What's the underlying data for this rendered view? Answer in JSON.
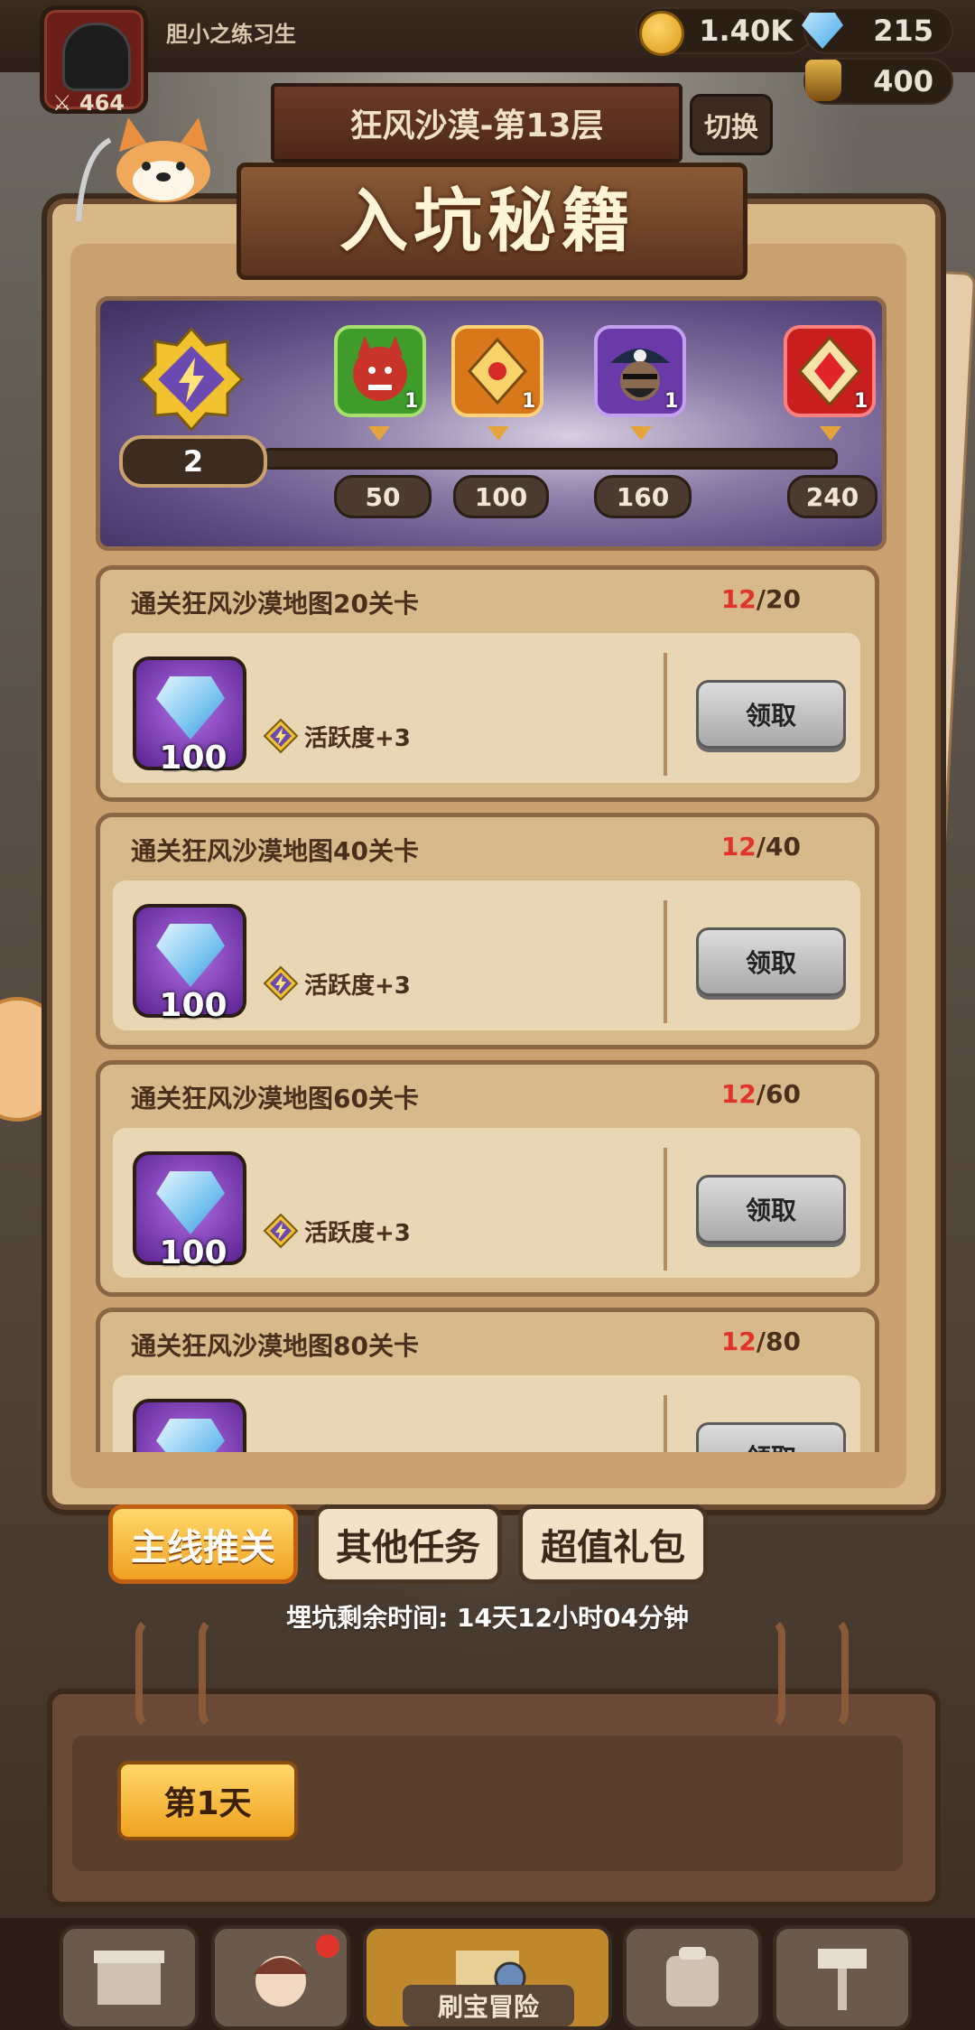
{
  "player": {
    "name": "胆小之练习生",
    "power": "464"
  },
  "resources": {
    "coins": "1.40K",
    "gems": "215",
    "potions": "400"
  },
  "stage": {
    "title": "狂风沙漠-第13层",
    "switch_label": "切换"
  },
  "panel": {
    "title": "入坑秘籍"
  },
  "track": {
    "level": "2",
    "milestones": [
      {
        "icon": "red-demon-portrait-icon",
        "count": "1",
        "threshold": "50",
        "color": "#3f9b2a"
      },
      {
        "icon": "gold-emblem-icon",
        "count": "1",
        "threshold": "100",
        "color": "#d8781a"
      },
      {
        "icon": "pirate-skull-portrait-icon",
        "count": "1",
        "threshold": "160",
        "color": "#6a3aa8"
      },
      {
        "icon": "red-gem-emblem-icon",
        "count": "1",
        "threshold": "240",
        "color": "#c81e1e"
      }
    ]
  },
  "tasks": [
    {
      "title": "通关狂风沙漠地图20关卡",
      "progress_current": "12",
      "progress_total": "/20",
      "reward_qty": "100",
      "activity": "活跃度+3",
      "button": "领取"
    },
    {
      "title": "通关狂风沙漠地图40关卡",
      "progress_current": "12",
      "progress_total": "/40",
      "reward_qty": "100",
      "activity": "活跃度+3",
      "button": "领取"
    },
    {
      "title": "通关狂风沙漠地图60关卡",
      "progress_current": "12",
      "progress_total": "/60",
      "reward_qty": "100",
      "activity": "活跃度+3",
      "button": "领取"
    },
    {
      "title": "通关狂风沙漠地图80关卡",
      "progress_current": "12",
      "progress_total": "/80",
      "reward_qty": "",
      "activity": "",
      "button": "领取"
    }
  ],
  "tabs": [
    {
      "label": "主线推关",
      "active": true
    },
    {
      "label": "其他任务",
      "active": false
    },
    {
      "label": "超值礼包",
      "active": false
    }
  ],
  "timer": "埋坑剩余时间: 14天12小时04分钟",
  "day_button": "第1天",
  "bottom_nav": {
    "active_label": "刷宝冒险"
  }
}
